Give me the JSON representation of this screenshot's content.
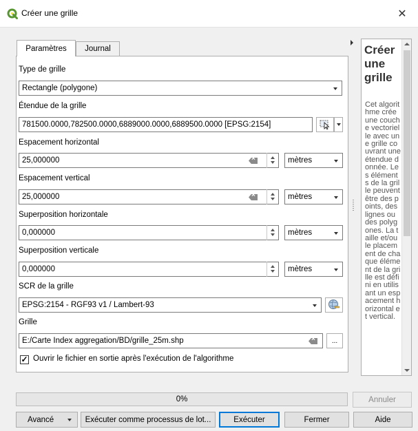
{
  "window": {
    "title": "Créer une grille",
    "close_glyph": "✕"
  },
  "tabs": [
    {
      "label": "Paramètres"
    },
    {
      "label": "Journal"
    }
  ],
  "params": {
    "grid_type_label": "Type de grille",
    "grid_type_value": "Rectangle (polygone)",
    "extent_label": "Étendue de la grille",
    "extent_value": "781500.0000,782500.0000,6889000.0000,6889500.0000 [EPSG:2154]",
    "h_spacing_label": "Espacement horizontal",
    "h_spacing_value": "25,000000",
    "h_spacing_unit": "mètres",
    "v_spacing_label": "Espacement vertical",
    "v_spacing_value": "25,000000",
    "v_spacing_unit": "mètres",
    "h_overlay_label": "Superposition horizontale",
    "h_overlay_value": "0,000000",
    "h_overlay_unit": "mètres",
    "v_overlay_label": "Superposition verticale",
    "v_overlay_value": "0,000000",
    "v_overlay_unit": "mètres",
    "crs_label": "SCR de la grille",
    "crs_value": "EPSG:2154 - RGF93 v1 / Lambert-93",
    "output_label": "Grille",
    "output_value": "E:/Carte Index aggregation/BD/grille_25m.shp",
    "browse_label": "...",
    "open_output_label": "Ouvrir le fichier en sortie après l'exécution de l'algorithme",
    "open_output_checked": true,
    "check_glyph": "✓"
  },
  "help": {
    "title": "Créer une grille",
    "body": "Cet algorithme crée une couche vectorielle avec une grille couvrant une étendue donnée. Les éléments de la grille peuvent être des points, des lignes ou des polygones. La taille et/ou le placement de chaque élément de la grille est défini en utilisant un espacement horizontal et vertical."
  },
  "progress": {
    "text": "0%",
    "value": 0
  },
  "buttons": {
    "advanced": "Avancé",
    "batch": "Exécuter comme processus de lot...",
    "run": "Exécuter",
    "close": "Fermer",
    "cancel": "Annuler",
    "help": "Aide"
  },
  "colors": {
    "accent": "#0078d7",
    "qgis_green": "#589632",
    "qgis_yellow": "#f0e64a",
    "progress_fill": "#06b025"
  }
}
